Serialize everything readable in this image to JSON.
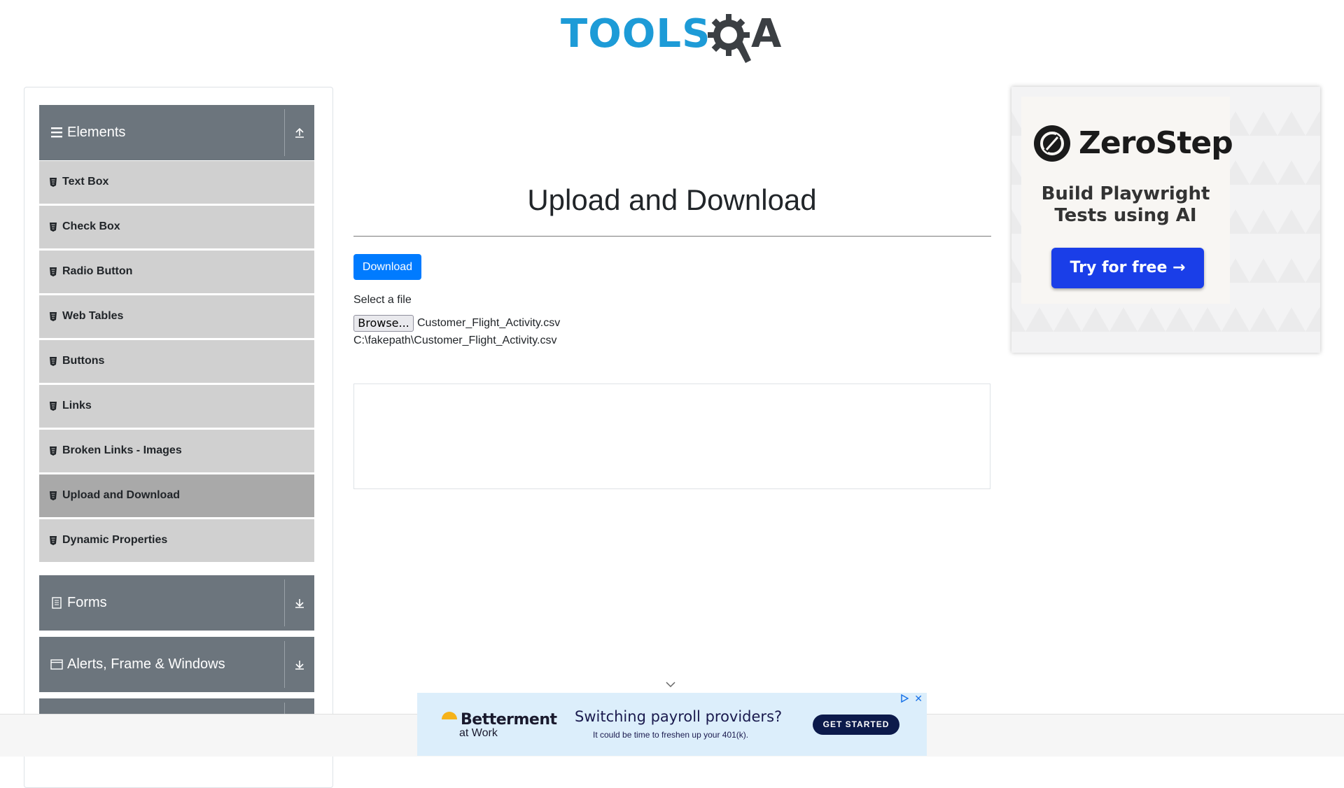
{
  "header": {
    "logo_text": "TOOLS",
    "logo_suffix": "A"
  },
  "sidebar": {
    "groups": [
      {
        "label": "Elements",
        "icon": "menu-icon",
        "toggle_icon": "collapse-icon"
      },
      {
        "label": "Forms",
        "icon": "form-icon",
        "toggle_icon": "expand-icon"
      },
      {
        "label": "Alerts, Frame & Windows",
        "icon": "window-icon",
        "toggle_icon": "expand-icon"
      }
    ],
    "items": [
      {
        "label": "Text Box"
      },
      {
        "label": "Check Box"
      },
      {
        "label": "Radio Button"
      },
      {
        "label": "Web Tables"
      },
      {
        "label": "Buttons"
      },
      {
        "label": "Links"
      },
      {
        "label": "Broken Links - Images"
      },
      {
        "label": "Upload and Download",
        "active": true
      },
      {
        "label": "Dynamic Properties"
      }
    ]
  },
  "main": {
    "title": "Upload and Download",
    "download_label": "Download",
    "select_label": "Select a file",
    "browse_label": "Browse...",
    "file_name": "Customer_Flight_Activity.csv",
    "uploaded_path": "C:\\fakepath\\Customer_Flight_Activity.csv"
  },
  "right_ad": {
    "brand": "ZeroStep",
    "tagline_line1": "Build Playwright",
    "tagline_line2": "Tests using AI",
    "cta": "Try for free →"
  },
  "bottom_ad": {
    "brand": "Betterment",
    "brand_sub": "at Work",
    "headline": "Switching payroll providers?",
    "subline": "It could be time to freshen up your 401(k).",
    "cta": "GET STARTED",
    "close": "✕"
  },
  "colors": {
    "accent": "#007bff",
    "group_header": "#6c757d",
    "menu_item": "#d0d0d0",
    "menu_item_active": "#a9a9a9",
    "logo_blue": "#1d9bd7",
    "cta_blue": "#1a3ee8"
  }
}
